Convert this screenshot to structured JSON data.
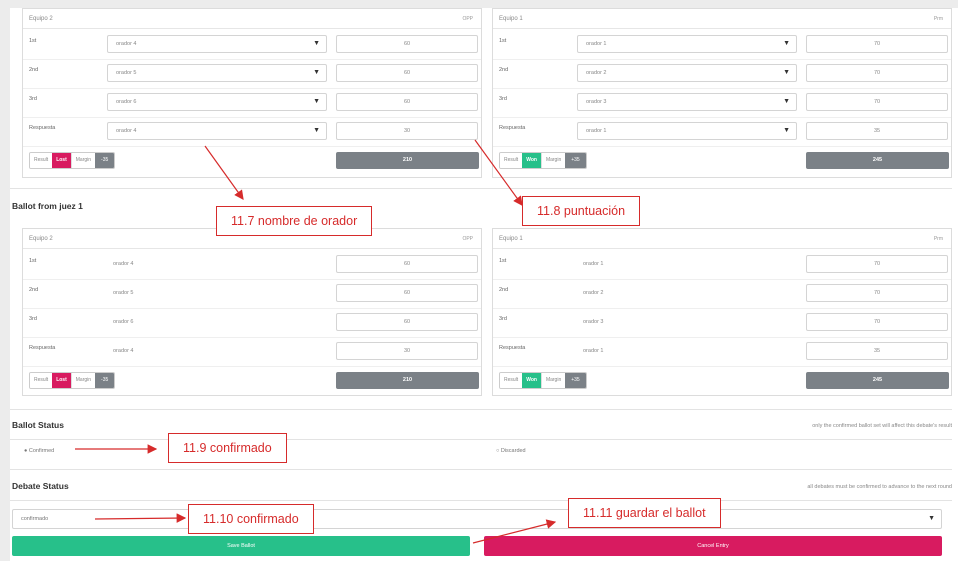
{
  "colors": {
    "won": "#27c08a",
    "lost": "#d81b60",
    "total_bg": "#7b8187",
    "annotation": "#d62b2b"
  },
  "top_panels": {
    "left": {
      "team": "Equipo 2",
      "side": "OPP",
      "rows": [
        {
          "position": "1st",
          "speaker": "orador 4",
          "score": "60"
        },
        {
          "position": "2nd",
          "speaker": "orador 5",
          "score": "60"
        },
        {
          "position": "3rd",
          "speaker": "orador 6",
          "score": "60"
        },
        {
          "position": "Respuesta",
          "speaker": "orador 4",
          "score": "30"
        }
      ],
      "result_label": "Result",
      "result": "Lost",
      "margin_label": "Margin",
      "margin": "-35",
      "total": "210"
    },
    "right": {
      "team": "Equipo 1",
      "side": "Prm",
      "rows": [
        {
          "position": "1st",
          "speaker": "orador 1",
          "score": "70"
        },
        {
          "position": "2nd",
          "speaker": "orador 2",
          "score": "70"
        },
        {
          "position": "3rd",
          "speaker": "orador 3",
          "score": "70"
        },
        {
          "position": "Respuesta",
          "speaker": "orador 1",
          "score": "35"
        }
      ],
      "result_label": "Result",
      "result": "Won",
      "margin_label": "Margin",
      "margin": "+35",
      "total": "245"
    }
  },
  "ballot_section": {
    "title": "Ballot from juez 1",
    "left": {
      "team": "Equipo 2",
      "side": "OPP",
      "rows": [
        {
          "position": "1st",
          "speaker": "orador 4",
          "score": "60"
        },
        {
          "position": "2nd",
          "speaker": "orador 5",
          "score": "60"
        },
        {
          "position": "3rd",
          "speaker": "orador 6",
          "score": "60"
        },
        {
          "position": "Respuesta",
          "speaker": "orador 4",
          "score": "30"
        }
      ],
      "result_label": "Result",
      "result": "Lost",
      "margin_label": "Margin",
      "margin": "-35",
      "total": "210"
    },
    "right": {
      "team": "Equipo 1",
      "side": "Prm",
      "rows": [
        {
          "position": "1st",
          "speaker": "orador 1",
          "score": "70"
        },
        {
          "position": "2nd",
          "speaker": "orador 2",
          "score": "70"
        },
        {
          "position": "3rd",
          "speaker": "orador 3",
          "score": "70"
        },
        {
          "position": "Respuesta",
          "speaker": "orador 1",
          "score": "35"
        }
      ],
      "result_label": "Result",
      "result": "Won",
      "margin_label": "Margin",
      "margin": "+35",
      "total": "245"
    }
  },
  "ballot_status": {
    "title": "Ballot Status",
    "note": "only the confirmed ballot set will affect this debate's result",
    "confirmed": "Confirmed",
    "discarded": "Discarded"
  },
  "debate_status": {
    "title": "Debate Status",
    "note": "all debates must be confirmed to advance to the next round",
    "value": "confirmado"
  },
  "buttons": {
    "save": "Save Ballot",
    "cancel": "Cancel Entry"
  },
  "annotations": {
    "a1": "11.7 nombre de orador",
    "a2": "11.8 puntuación",
    "a3": "11.9 confirmado",
    "a4": "11.10 confirmado",
    "a5": "11.11 guardar el ballot"
  }
}
